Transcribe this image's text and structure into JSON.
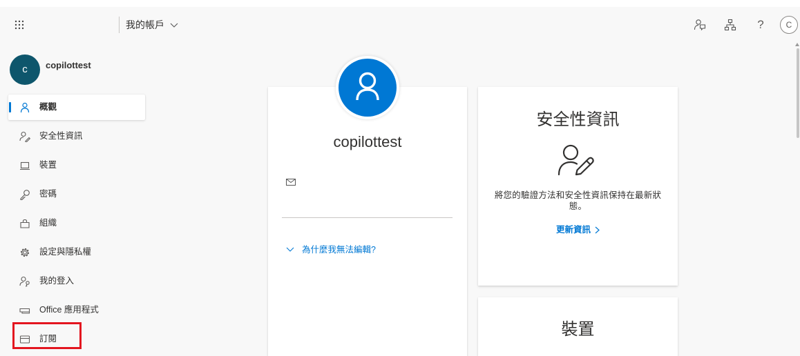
{
  "header": {
    "app_launcher_icon": "waffle-icon",
    "title": "我的帳戶",
    "title_icon": "chevron-down-icon",
    "right_icons": [
      "feedback-icon",
      "organization-icon",
      "help-icon"
    ],
    "help_glyph": "?",
    "avatar_initial": "C"
  },
  "sidebar": {
    "user": {
      "initial": "c",
      "name": "copilottest"
    },
    "items": [
      {
        "label": "概觀",
        "icon": "person-icon",
        "selected": true
      },
      {
        "label": "安全性資訊",
        "icon": "security-info-icon",
        "selected": false
      },
      {
        "label": "裝置",
        "icon": "laptop-icon",
        "selected": false
      },
      {
        "label": "密碼",
        "icon": "key-icon",
        "selected": false
      },
      {
        "label": "組織",
        "icon": "briefcase-icon",
        "selected": false
      },
      {
        "label": "設定與隱私權",
        "icon": "gear-icon",
        "selected": false
      },
      {
        "label": "我的登入",
        "icon": "sign-ins-icon",
        "selected": false
      },
      {
        "label": "Office 應用程式",
        "icon": "office-apps-icon",
        "selected": false
      },
      {
        "label": "訂閱",
        "icon": "subscription-icon",
        "selected": false,
        "highlighted": true
      }
    ]
  },
  "profile_card": {
    "avatar_icon": "person-icon",
    "name": "copilottest",
    "email_icon": "mail-icon",
    "why_cant_edit": "為什麼我無法編輯?"
  },
  "security_card": {
    "title": "安全性資訊",
    "icon": "person-pen-icon",
    "description": "將您的驗證方法和安全性資訊保持在最新狀態。",
    "link": "更新資訊",
    "link_icon": "chevron-right-icon"
  },
  "devices_card": {
    "title": "裝置"
  },
  "colors": {
    "accent": "#0078d4",
    "user_avatar": "#0e566c",
    "highlight_box": "#e3151f",
    "page_background": "#f8f8f8"
  }
}
